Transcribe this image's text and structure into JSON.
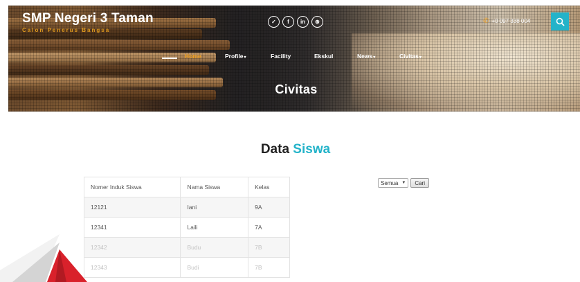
{
  "header": {
    "brand_title": "SMP Negeri 3 Taman",
    "brand_subtitle": "Calon Penerus Bangsa",
    "social_icons": [
      "twitter-icon",
      "facebook-icon",
      "linkedin-icon",
      "dribbble-icon"
    ],
    "social_glyphs": [
      "✓",
      "f",
      "in",
      "⊛"
    ],
    "phone": "+0 097 338 004",
    "accent_color": "#23b3c9",
    "active_color": "#f0a020"
  },
  "nav": {
    "items": [
      {
        "label": "Home",
        "caret": ""
      },
      {
        "label": "Profile",
        "caret": "▾"
      },
      {
        "label": "Facility",
        "caret": ""
      },
      {
        "label": "Ekskul",
        "caret": ""
      },
      {
        "label": "News",
        "caret": "▾"
      },
      {
        "label": "Civitas",
        "caret": "▾"
      }
    ]
  },
  "hero": {
    "title": "Civitas"
  },
  "section": {
    "title_main": "Data",
    "title_accent": "Siswa"
  },
  "table": {
    "headers": [
      "Nomer Induk Siswa",
      "Nama Siswa",
      "Kelas"
    ],
    "rows": [
      [
        "12121",
        "Iani",
        "9A"
      ],
      [
        "12341",
        "Laili",
        "7A"
      ],
      [
        "12342",
        "Budu",
        "7B"
      ],
      [
        "12343",
        "Budi",
        "7B"
      ]
    ]
  },
  "filter": {
    "select_value": "Semua",
    "button_label": "Cari"
  }
}
